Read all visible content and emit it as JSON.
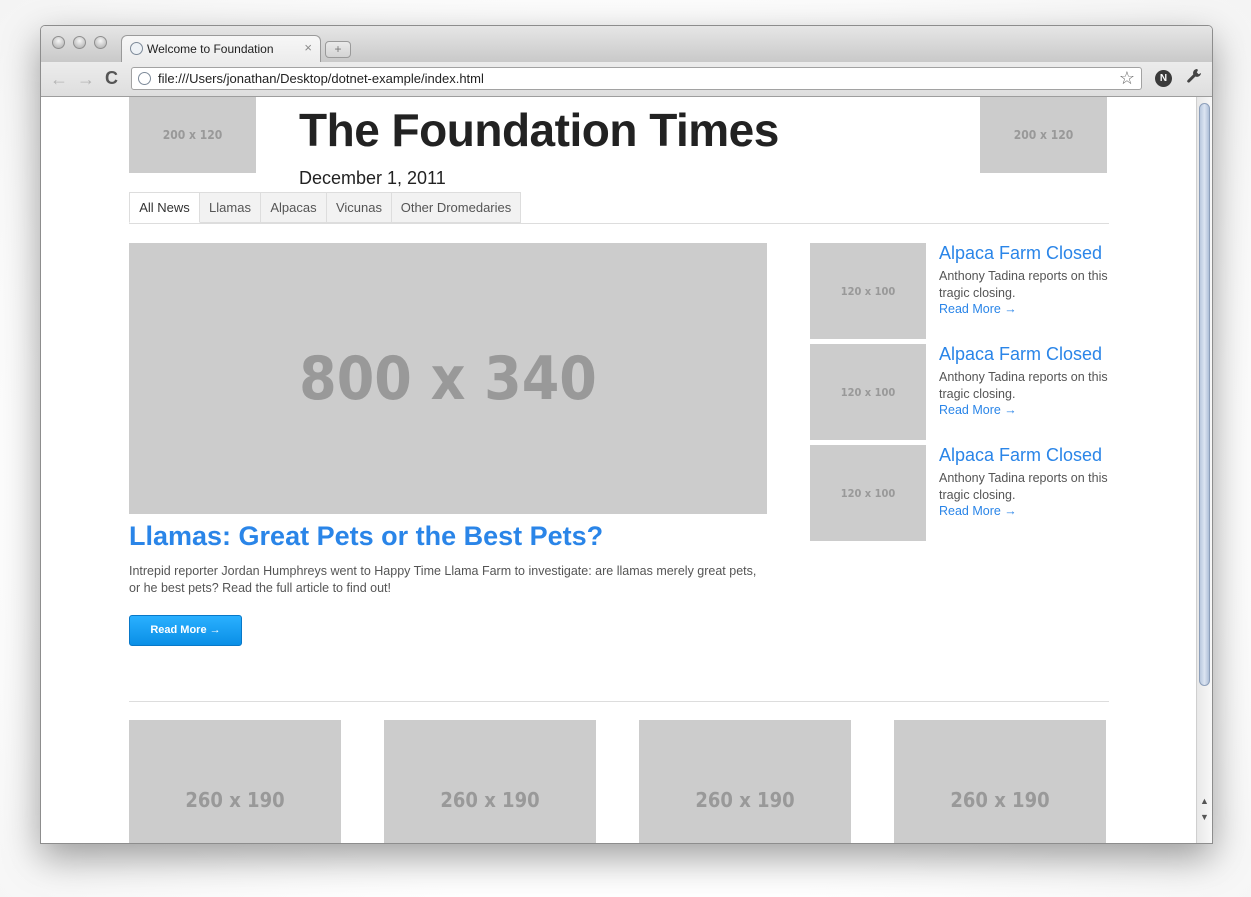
{
  "browser": {
    "tab_title": "Welcome to Foundation",
    "tab_close": "×",
    "new_tab": "+",
    "back": "←",
    "forward": "→",
    "reload": "C",
    "url": "file:///Users/jonathan/Desktop/dotnet-example/index.html",
    "bookmark_star": "☆",
    "extension_label": "N",
    "wrench": "🔧"
  },
  "header": {
    "ad_left": "200 x 120",
    "ad_right": "200 x 120",
    "title": "The Foundation Times",
    "date": "December 1, 2011"
  },
  "nav": {
    "tabs": [
      {
        "label": "All News"
      },
      {
        "label": "Llamas"
      },
      {
        "label": "Alpacas"
      },
      {
        "label": "Vicunas"
      },
      {
        "label": "Other Dromedaries"
      }
    ]
  },
  "feature": {
    "image": "800 x 340",
    "title": "Llamas: Great Pets or the Best Pets?",
    "text": "Intrepid reporter Jordan Humphreys went to Happy Time Llama Farm to investigate: are llamas merely great pets, or he best pets? Read the full article to find out!",
    "button": "Read More →"
  },
  "side_stories": [
    {
      "image": "120 x 100",
      "title": "Alpaca Farm Closed",
      "text": "Anthony Tadina reports on this tragic closing.",
      "link": "Read More →"
    },
    {
      "image": "120 x 100",
      "title": "Alpaca Farm Closed",
      "text": "Anthony Tadina reports on this tragic closing.",
      "link": "Read More →"
    },
    {
      "image": "120 x 100",
      "title": "Alpaca Farm Closed",
      "text": "Anthony Tadina reports on this tragic closing.",
      "link": "Read More →"
    }
  ],
  "thumbnails": [
    {
      "label": "260 x 190"
    },
    {
      "label": "260 x 190"
    },
    {
      "label": "260 x 190"
    },
    {
      "label": "260 x 190"
    }
  ],
  "scrollbar": {
    "up": "▲",
    "down": "▼"
  }
}
